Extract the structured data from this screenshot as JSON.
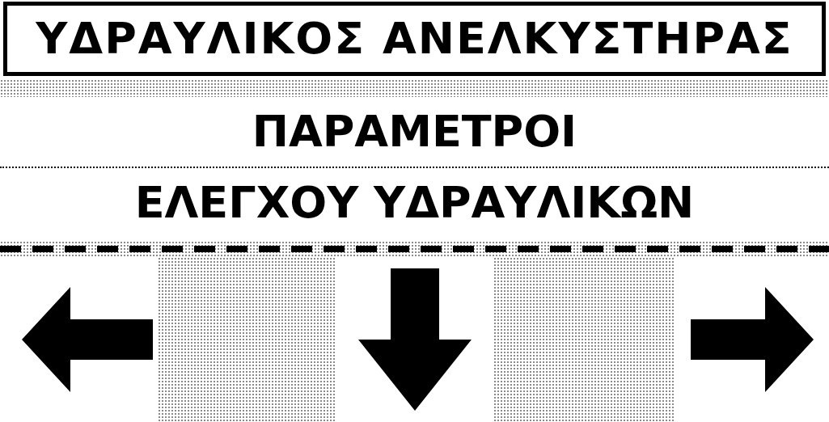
{
  "title": "ΥΔΡΑΥΛΙΚΟΣ ΑΝΕΛΚΥΣΤΗΡΑΣ",
  "lines": [
    "ΠΑΡΑΜΕΤΡΟΙ",
    "ΕΛΕΓΧΟΥ ΥΔΡΑΥΛΙΚΩΝ"
  ],
  "softkeys": [
    {
      "kind": "left"
    },
    {
      "kind": "down"
    },
    {
      "kind": "right"
    }
  ]
}
